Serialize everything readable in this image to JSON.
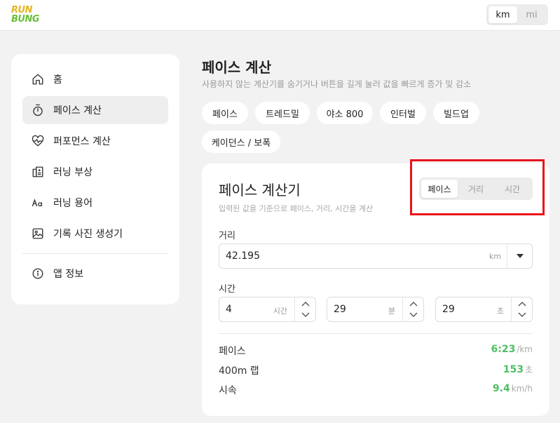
{
  "logo": {
    "line1": "RUN",
    "line2": "BUNG"
  },
  "unit_toggle": {
    "options": [
      "km",
      "mi"
    ],
    "selected": "km"
  },
  "sidebar": {
    "items": [
      {
        "label": "홈",
        "icon": "home-icon"
      },
      {
        "label": "페이스 계산",
        "icon": "stopwatch-icon"
      },
      {
        "label": "퍼포먼스 계산",
        "icon": "heart-pulse-icon"
      },
      {
        "label": "러닝 부상",
        "icon": "hospital-icon"
      },
      {
        "label": "러닝 용어",
        "icon": "text-icon"
      },
      {
        "label": "기록 사진 생성기",
        "icon": "image-icon"
      }
    ],
    "footer_item": {
      "label": "앱 정보",
      "icon": "info-icon"
    },
    "active_index": 1
  },
  "page": {
    "title": "페이스 계산",
    "subtitle": "사용하지 않는 계산기를 숨기거나 버튼을 길게 눌러 값을 빠르게 증가 및 감소"
  },
  "chips": [
    "페이스",
    "트레드밀",
    "야소 800",
    "인터벌",
    "빌드업",
    "케이던스 / 보폭"
  ],
  "calculator": {
    "title": "페이스 계산기",
    "subtitle": "입력된 값을 기준으로 페이스, 거리, 시간을 계산",
    "modes": [
      "페이스",
      "거리",
      "시간"
    ],
    "selected_mode": "페이스",
    "distance": {
      "label": "거리",
      "value": "42.195",
      "unit": "km"
    },
    "time": {
      "label": "시간",
      "hours": {
        "value": "4",
        "unit": "시간"
      },
      "minutes": {
        "value": "29",
        "unit": "분"
      },
      "seconds": {
        "value": "29",
        "unit": "초"
      }
    },
    "results": [
      {
        "label": "페이스",
        "value": "6:23",
        "unit": "/km"
      },
      {
        "label": "400m 랩",
        "value": "153",
        "unit": "초"
      },
      {
        "label": "시속",
        "value": "9.4",
        "unit": "km/h"
      }
    ]
  },
  "colors": {
    "accent_green": "#4fbf63",
    "highlight_red": "#e8141c",
    "logo_yellow": "#e5b521",
    "logo_green": "#6bbf3a"
  }
}
